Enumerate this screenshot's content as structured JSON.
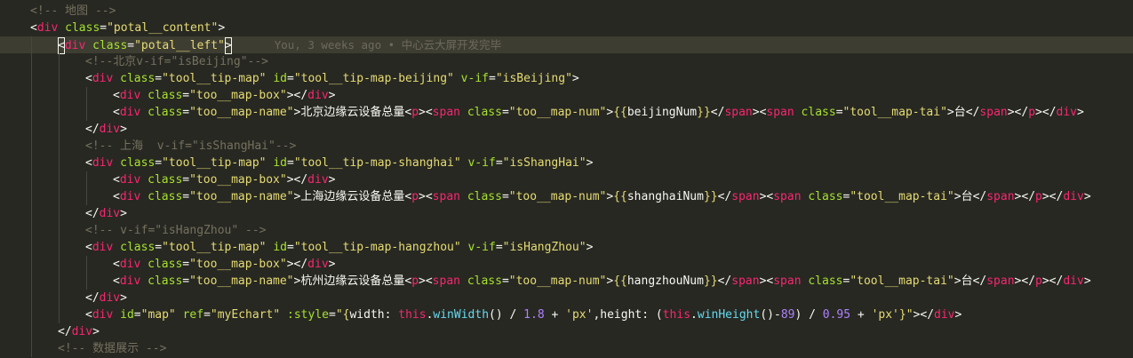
{
  "editor": {
    "blame": "You, 3 weeks ago • 中心云大屏开发完毕",
    "lines": [
      {
        "indent": 1,
        "tokens": [
          [
            "comment",
            "<!-- 地图 -->"
          ]
        ]
      },
      {
        "indent": 1,
        "tokens": [
          [
            "punc",
            "<"
          ],
          [
            "tag",
            "div"
          ],
          [
            "punc",
            " "
          ],
          [
            "attr",
            "class"
          ],
          [
            "punc",
            "="
          ],
          [
            "str",
            "\"potal__content\""
          ],
          [
            "punc",
            ">"
          ]
        ]
      },
      {
        "indent": 2,
        "current": true,
        "tokens": [
          [
            "punc",
            "<"
          ],
          [
            "tag",
            "div"
          ],
          [
            "punc",
            " "
          ],
          [
            "attr",
            "class"
          ],
          [
            "punc",
            "="
          ],
          [
            "str",
            "\"potal__left\""
          ],
          [
            "punc",
            ">"
          ]
        ]
      },
      {
        "indent": 3,
        "tokens": [
          [
            "comment",
            "<!--北京v-if=\"isBeijing\"-->"
          ]
        ]
      },
      {
        "indent": 3,
        "tokens": [
          [
            "punc",
            "<"
          ],
          [
            "tag",
            "div"
          ],
          [
            "punc",
            " "
          ],
          [
            "attr",
            "class"
          ],
          [
            "punc",
            "="
          ],
          [
            "str",
            "\"tool__tip-map\""
          ],
          [
            "punc",
            " "
          ],
          [
            "attr",
            "id"
          ],
          [
            "punc",
            "="
          ],
          [
            "str",
            "\"tool__tip-map-beijing\""
          ],
          [
            "punc",
            " "
          ],
          [
            "attr",
            "v-if"
          ],
          [
            "punc",
            "="
          ],
          [
            "str",
            "\"isBeijing\""
          ],
          [
            "punc",
            ">"
          ]
        ]
      },
      {
        "indent": 4,
        "tokens": [
          [
            "punc",
            "<"
          ],
          [
            "tag",
            "div"
          ],
          [
            "punc",
            " "
          ],
          [
            "attr",
            "class"
          ],
          [
            "punc",
            "="
          ],
          [
            "str",
            "\"too__map-box\""
          ],
          [
            "punc",
            "></"
          ],
          [
            "tag",
            "div"
          ],
          [
            "punc",
            ">"
          ]
        ]
      },
      {
        "indent": 4,
        "tokens": [
          [
            "punc",
            "<"
          ],
          [
            "tag",
            "div"
          ],
          [
            "punc",
            " "
          ],
          [
            "attr",
            "class"
          ],
          [
            "punc",
            "="
          ],
          [
            "str",
            "\"too__map-name\""
          ],
          [
            "punc",
            ">"
          ],
          [
            "text",
            "北京边缘云设备总量"
          ],
          [
            "punc",
            "<"
          ],
          [
            "tag",
            "p"
          ],
          [
            "punc",
            "><"
          ],
          [
            "tag",
            "span"
          ],
          [
            "punc",
            " "
          ],
          [
            "attr",
            "class"
          ],
          [
            "punc",
            "="
          ],
          [
            "str",
            "\"too__map-num\""
          ],
          [
            "punc",
            ">"
          ],
          [
            "str",
            "{{"
          ],
          [
            "text",
            "beijingNum"
          ],
          [
            "str",
            "}}"
          ],
          [
            "punc",
            "</"
          ],
          [
            "tag",
            "span"
          ],
          [
            "punc",
            "><"
          ],
          [
            "tag",
            "span"
          ],
          [
            "punc",
            " "
          ],
          [
            "attr",
            "class"
          ],
          [
            "punc",
            "="
          ],
          [
            "str",
            "\"tool__map-tai\""
          ],
          [
            "punc",
            ">"
          ],
          [
            "text",
            "台"
          ],
          [
            "punc",
            "</"
          ],
          [
            "tag",
            "span"
          ],
          [
            "punc",
            "></"
          ],
          [
            "tag",
            "p"
          ],
          [
            "punc",
            "></"
          ],
          [
            "tag",
            "div"
          ],
          [
            "punc",
            ">"
          ]
        ]
      },
      {
        "indent": 3,
        "tokens": [
          [
            "punc",
            "</"
          ],
          [
            "tag",
            "div"
          ],
          [
            "punc",
            ">"
          ]
        ]
      },
      {
        "indent": 3,
        "tokens": [
          [
            "comment",
            "<!-- 上海  v-if=\"isShangHai\"-->"
          ]
        ]
      },
      {
        "indent": 3,
        "tokens": [
          [
            "punc",
            "<"
          ],
          [
            "tag",
            "div"
          ],
          [
            "punc",
            " "
          ],
          [
            "attr",
            "class"
          ],
          [
            "punc",
            "="
          ],
          [
            "str",
            "\"tool__tip-map\""
          ],
          [
            "punc",
            " "
          ],
          [
            "attr",
            "id"
          ],
          [
            "punc",
            "="
          ],
          [
            "str",
            "\"tool__tip-map-shanghai\""
          ],
          [
            "punc",
            " "
          ],
          [
            "attr",
            "v-if"
          ],
          [
            "punc",
            "="
          ],
          [
            "str",
            "\"isShangHai\""
          ],
          [
            "punc",
            ">"
          ]
        ]
      },
      {
        "indent": 4,
        "tokens": [
          [
            "punc",
            "<"
          ],
          [
            "tag",
            "div"
          ],
          [
            "punc",
            " "
          ],
          [
            "attr",
            "class"
          ],
          [
            "punc",
            "="
          ],
          [
            "str",
            "\"too__map-box\""
          ],
          [
            "punc",
            "></"
          ],
          [
            "tag",
            "div"
          ],
          [
            "punc",
            ">"
          ]
        ]
      },
      {
        "indent": 4,
        "tokens": [
          [
            "punc",
            "<"
          ],
          [
            "tag",
            "div"
          ],
          [
            "punc",
            " "
          ],
          [
            "attr",
            "class"
          ],
          [
            "punc",
            "="
          ],
          [
            "str",
            "\"too__map-name\""
          ],
          [
            "punc",
            ">"
          ],
          [
            "text",
            "上海边缘云设备总量"
          ],
          [
            "punc",
            "<"
          ],
          [
            "tag",
            "p"
          ],
          [
            "punc",
            "><"
          ],
          [
            "tag",
            "span"
          ],
          [
            "punc",
            " "
          ],
          [
            "attr",
            "class"
          ],
          [
            "punc",
            "="
          ],
          [
            "str",
            "\"too__map-num\""
          ],
          [
            "punc",
            ">"
          ],
          [
            "str",
            "{{"
          ],
          [
            "text",
            "shanghaiNum"
          ],
          [
            "str",
            "}}"
          ],
          [
            "punc",
            "</"
          ],
          [
            "tag",
            "span"
          ],
          [
            "punc",
            "><"
          ],
          [
            "tag",
            "span"
          ],
          [
            "punc",
            " "
          ],
          [
            "attr",
            "class"
          ],
          [
            "punc",
            "="
          ],
          [
            "str",
            "\"tool__map-tai\""
          ],
          [
            "punc",
            ">"
          ],
          [
            "text",
            "台"
          ],
          [
            "punc",
            "</"
          ],
          [
            "tag",
            "span"
          ],
          [
            "punc",
            "></"
          ],
          [
            "tag",
            "p"
          ],
          [
            "punc",
            "></"
          ],
          [
            "tag",
            "div"
          ],
          [
            "punc",
            ">"
          ]
        ]
      },
      {
        "indent": 3,
        "tokens": [
          [
            "punc",
            "</"
          ],
          [
            "tag",
            "div"
          ],
          [
            "punc",
            ">"
          ]
        ]
      },
      {
        "indent": 3,
        "tokens": [
          [
            "comment",
            "<!-- v-if=\"isHangZhou\" -->"
          ]
        ]
      },
      {
        "indent": 3,
        "tokens": [
          [
            "punc",
            "<"
          ],
          [
            "tag",
            "div"
          ],
          [
            "punc",
            " "
          ],
          [
            "attr",
            "class"
          ],
          [
            "punc",
            "="
          ],
          [
            "str",
            "\"tool__tip-map\""
          ],
          [
            "punc",
            " "
          ],
          [
            "attr",
            "id"
          ],
          [
            "punc",
            "="
          ],
          [
            "str",
            "\"tool__tip-map-hangzhou\""
          ],
          [
            "punc",
            " "
          ],
          [
            "attr",
            "v-if"
          ],
          [
            "punc",
            "="
          ],
          [
            "str",
            "\"isHangZhou\""
          ],
          [
            "punc",
            ">"
          ]
        ]
      },
      {
        "indent": 4,
        "tokens": [
          [
            "punc",
            "<"
          ],
          [
            "tag",
            "div"
          ],
          [
            "punc",
            " "
          ],
          [
            "attr",
            "class"
          ],
          [
            "punc",
            "="
          ],
          [
            "str",
            "\"too__map-box\""
          ],
          [
            "punc",
            "></"
          ],
          [
            "tag",
            "div"
          ],
          [
            "punc",
            ">"
          ]
        ]
      },
      {
        "indent": 4,
        "tokens": [
          [
            "punc",
            "<"
          ],
          [
            "tag",
            "div"
          ],
          [
            "punc",
            " "
          ],
          [
            "attr",
            "class"
          ],
          [
            "punc",
            "="
          ],
          [
            "str",
            "\"too__map-name\""
          ],
          [
            "punc",
            ">"
          ],
          [
            "text",
            "杭州边缘云设备总量"
          ],
          [
            "punc",
            "<"
          ],
          [
            "tag",
            "p"
          ],
          [
            "punc",
            "><"
          ],
          [
            "tag",
            "span"
          ],
          [
            "punc",
            " "
          ],
          [
            "attr",
            "class"
          ],
          [
            "punc",
            "="
          ],
          [
            "str",
            "\"too__map-num\""
          ],
          [
            "punc",
            ">"
          ],
          [
            "str",
            "{{"
          ],
          [
            "text",
            "hangzhouNum"
          ],
          [
            "str",
            "}}"
          ],
          [
            "punc",
            "</"
          ],
          [
            "tag",
            "span"
          ],
          [
            "punc",
            "><"
          ],
          [
            "tag",
            "span"
          ],
          [
            "punc",
            " "
          ],
          [
            "attr",
            "class"
          ],
          [
            "punc",
            "="
          ],
          [
            "str",
            "\"tool__map-tai\""
          ],
          [
            "punc",
            ">"
          ],
          [
            "text",
            "台"
          ],
          [
            "punc",
            "</"
          ],
          [
            "tag",
            "span"
          ],
          [
            "punc",
            "></"
          ],
          [
            "tag",
            "p"
          ],
          [
            "punc",
            "></"
          ],
          [
            "tag",
            "div"
          ],
          [
            "punc",
            ">"
          ]
        ]
      },
      {
        "indent": 3,
        "tokens": [
          [
            "punc",
            "</"
          ],
          [
            "tag",
            "div"
          ],
          [
            "punc",
            ">"
          ]
        ]
      },
      {
        "indent": 3,
        "tokens": [
          [
            "punc",
            "<"
          ],
          [
            "tag",
            "div"
          ],
          [
            "punc",
            " "
          ],
          [
            "attr",
            "id"
          ],
          [
            "punc",
            "="
          ],
          [
            "str",
            "\"map\""
          ],
          [
            "punc",
            " "
          ],
          [
            "attr",
            "ref"
          ],
          [
            "punc",
            "="
          ],
          [
            "str",
            "\"myEchart\""
          ],
          [
            "punc",
            " "
          ],
          [
            "attr",
            ":style"
          ],
          [
            "punc",
            "="
          ],
          [
            "str",
            "\"{"
          ],
          [
            "text",
            "width: "
          ],
          [
            "kw",
            "this"
          ],
          [
            "text",
            "."
          ],
          [
            "fn",
            "winWidth"
          ],
          [
            "text",
            "() / "
          ],
          [
            "num",
            "1.8"
          ],
          [
            "text",
            " + "
          ],
          [
            "str",
            "'px'"
          ],
          [
            "text",
            ",height: ("
          ],
          [
            "kw",
            "this"
          ],
          [
            "text",
            "."
          ],
          [
            "fn",
            "winHeight"
          ],
          [
            "text",
            "()-"
          ],
          [
            "num",
            "89"
          ],
          [
            "text",
            ") / "
          ],
          [
            "num",
            "0.95"
          ],
          [
            "text",
            " + "
          ],
          [
            "str",
            "'px'"
          ],
          [
            "str",
            "}\""
          ],
          [
            "punc",
            "></"
          ],
          [
            "tag",
            "div"
          ],
          [
            "punc",
            ">"
          ]
        ]
      },
      {
        "indent": 2,
        "tokens": [
          [
            "punc",
            "</"
          ],
          [
            "tag",
            "div"
          ],
          [
            "punc",
            ">"
          ]
        ]
      },
      {
        "indent": 2,
        "tokens": [
          [
            "comment",
            "<!-- 数据展示 -->"
          ]
        ]
      }
    ]
  }
}
